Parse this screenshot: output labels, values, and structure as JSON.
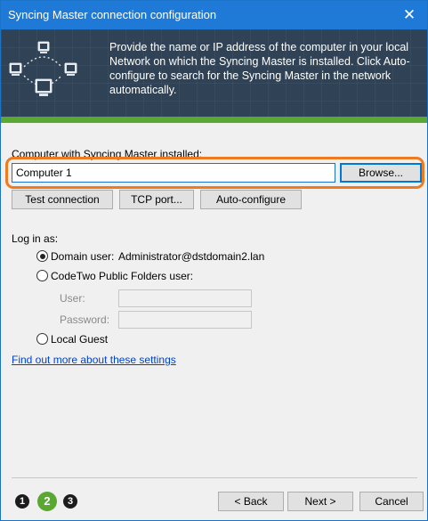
{
  "window": {
    "title": "Syncing Master connection configuration",
    "close_glyph": "✕"
  },
  "banner": {
    "icon": "network-computers-icon",
    "description": "Provide the name or IP address of the computer in your local Network on which the Syncing Master is installed. Click Auto-configure to search for the Syncing Master in the network automatically."
  },
  "computer": {
    "label": "Computer with Syncing Master installed:",
    "value": "Computer 1",
    "browse_label": "Browse..."
  },
  "actions": {
    "test_label": "Test connection",
    "tcp_label": "TCP port...",
    "autoconfig_label": "Auto-configure"
  },
  "login": {
    "heading": "Log in as:",
    "domain_label": "Domain user:",
    "domain_value": "Administrator@dstdomain2.lan",
    "public_folders_label": "CodeTwo Public Folders user:",
    "user_label": "User:",
    "user_value": "",
    "password_label": "Password:",
    "password_value": "",
    "local_guest_label": "Local Guest",
    "selected": "domain"
  },
  "help_link": "Find out more about these settings",
  "footer": {
    "steps": [
      "1",
      "2",
      "3"
    ],
    "active_step": 2,
    "back_label": "< Back",
    "next_label": "Next >",
    "cancel_label": "Cancel"
  },
  "colors": {
    "titlebar": "#1e7ad6",
    "banner": "#2f4256",
    "accent_green": "#5aa832",
    "highlight_orange": "#ee7a22",
    "link": "#0044cc"
  }
}
